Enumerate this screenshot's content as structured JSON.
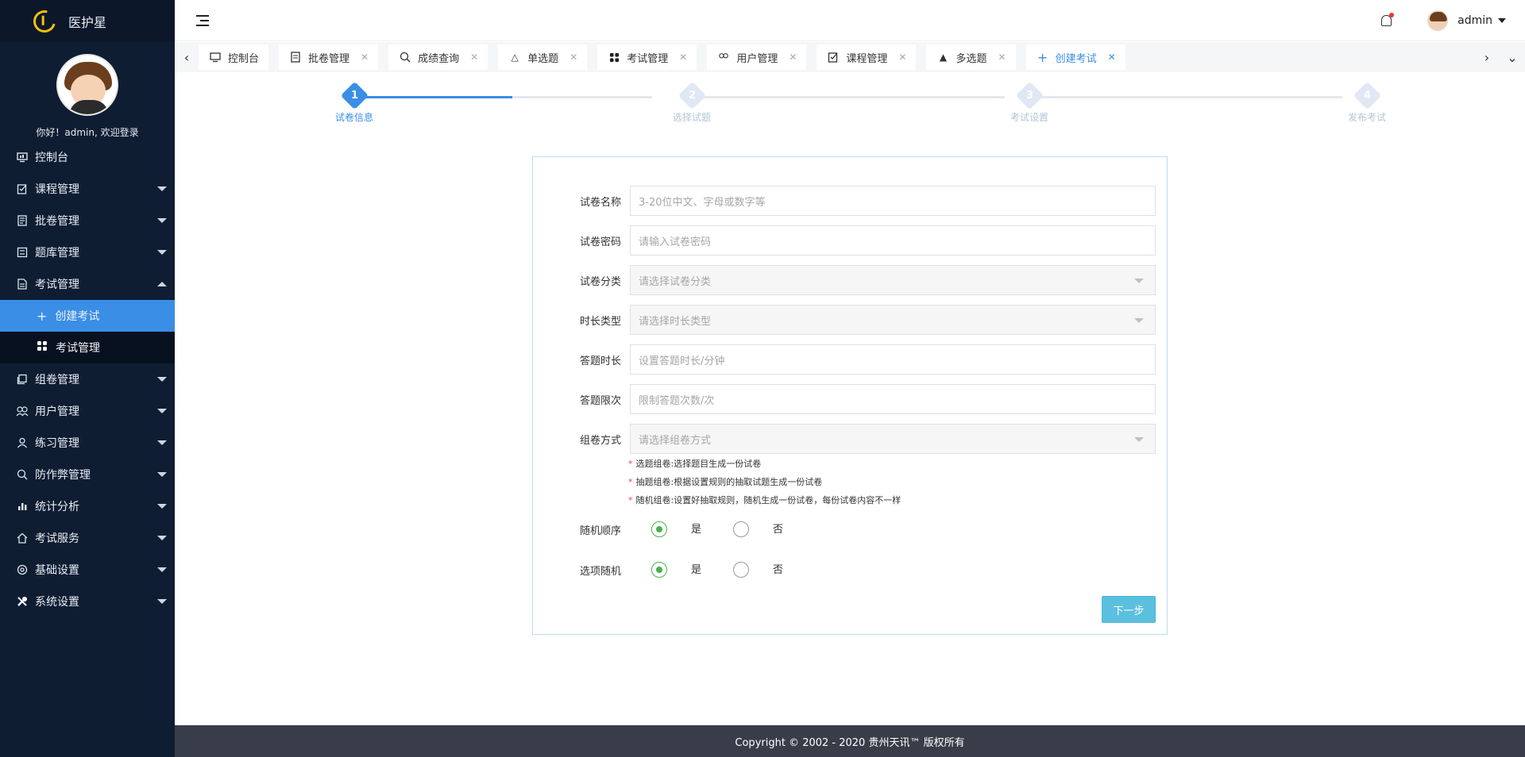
{
  "app": {
    "title": "医护星"
  },
  "user": {
    "welcome": "你好！admin, 欢迎登录",
    "name": "admin"
  },
  "sidebar": {
    "items": [
      {
        "label": "控制台",
        "icon": "monitor-icon"
      },
      {
        "label": "课程管理",
        "icon": "course-icon"
      },
      {
        "label": "批卷管理",
        "icon": "marking-icon"
      },
      {
        "label": "题库管理",
        "icon": "question-bank-icon"
      },
      {
        "label": "考试管理",
        "icon": "exam-icon"
      }
    ],
    "exam_sub": [
      {
        "label": "创建考试",
        "icon": "plus-icon"
      },
      {
        "label": "考试管理",
        "icon": "grid-icon"
      }
    ],
    "items2": [
      {
        "label": "组卷管理",
        "icon": "paper-icon"
      },
      {
        "label": "用户管理",
        "icon": "users-icon"
      },
      {
        "label": "练习管理",
        "icon": "user-icon"
      },
      {
        "label": "防作弊管理",
        "icon": "shield-icon"
      },
      {
        "label": "统计分析",
        "icon": "bar-chart-icon"
      },
      {
        "label": "考试服务",
        "icon": "home-icon"
      },
      {
        "label": "基础设置",
        "icon": "gear-icon"
      },
      {
        "label": "系统设置",
        "icon": "tools-icon"
      }
    ]
  },
  "tabs": [
    {
      "label": "控制台",
      "icon": "monitor-icon"
    },
    {
      "label": "批卷管理",
      "icon": "marking-icon"
    },
    {
      "label": "成绩查询",
      "icon": "search-icon"
    },
    {
      "label": "单选题",
      "icon": "triangle-outline-icon"
    },
    {
      "label": "考试管理",
      "icon": "grid-icon"
    },
    {
      "label": "用户管理",
      "icon": "users-icon"
    },
    {
      "label": "课程管理",
      "icon": "course-icon"
    },
    {
      "label": "多选题",
      "icon": "triangle-filled-icon"
    },
    {
      "label": "创建考试",
      "icon": "plus-icon",
      "active": true
    }
  ],
  "steps": [
    {
      "num": "1",
      "label": "试卷信息"
    },
    {
      "num": "2",
      "label": "选择试题"
    },
    {
      "num": "3",
      "label": "考试设置"
    },
    {
      "num": "4",
      "label": "发布考试"
    }
  ],
  "form": {
    "fields": [
      {
        "label": "试卷名称",
        "placeholder": "3-20位中文、字母或数字等"
      },
      {
        "label": "试卷密码",
        "placeholder": "请输入试卷密码"
      },
      {
        "label": "试卷分类",
        "placeholder": "请选择试卷分类"
      },
      {
        "label": "时长类型",
        "placeholder": "请选择时长类型"
      },
      {
        "label": "答题时长",
        "placeholder": "设置答题时长/分钟"
      },
      {
        "label": "答题限次",
        "placeholder": "限制答题次数/次"
      },
      {
        "label": "组卷方式",
        "placeholder": "请选择组卷方式"
      }
    ],
    "notes": [
      "选题组卷:选择题目生成一份试卷",
      "抽题组卷:根据设置规则的抽取试题生成一份试卷",
      "随机组卷:设置好抽取规则，随机生成一份试卷，每份试卷内容不一样"
    ],
    "random_order": {
      "label": "随机顺序",
      "yes": "是",
      "no": "否",
      "value": "是"
    },
    "option_random": {
      "label": "选项随机",
      "yes": "是",
      "no": "否",
      "value": "是"
    },
    "next_label": "下一步"
  },
  "footer": {
    "text": "Copyright  © 2002 - 2020 贵州天讯™ 版权所有"
  }
}
